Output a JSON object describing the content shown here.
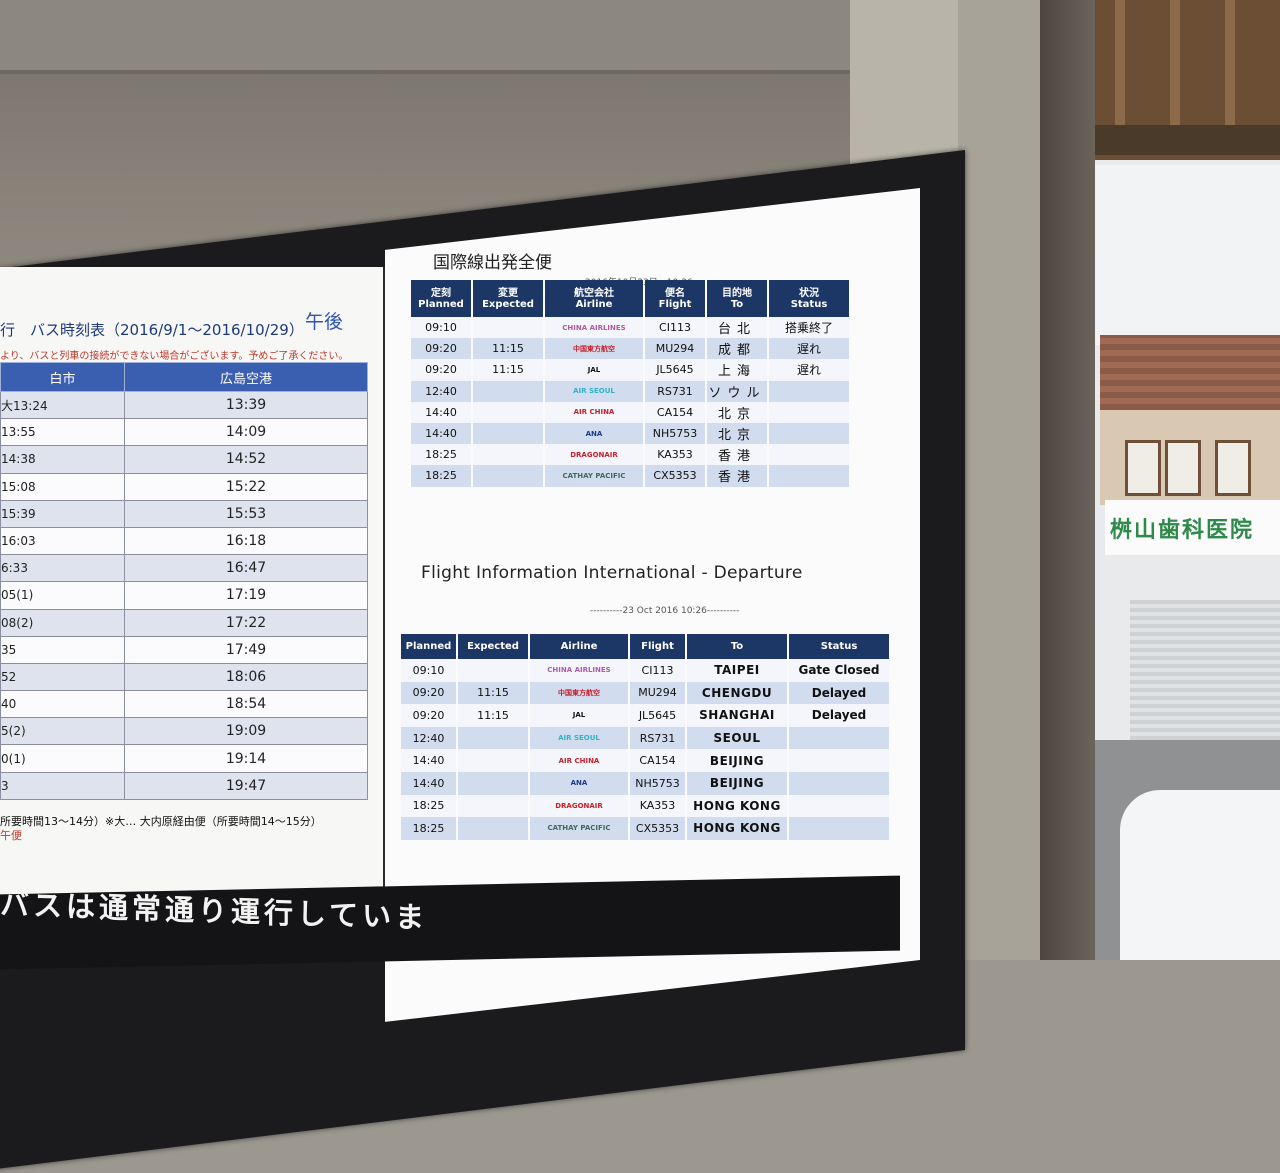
{
  "bus": {
    "title": "行　バス時刻表（2016/9/1〜2016/10/29）",
    "period": "午後",
    "note": "より、バスと列車の接続ができない場合がございます。予めご了承ください。",
    "col_from": "白市",
    "col_to": "広島空港",
    "rows": [
      {
        "from": "大13:24",
        "to": "13:39"
      },
      {
        "from": "13:55",
        "to": "14:09"
      },
      {
        "from": "14:38",
        "to": "14:52"
      },
      {
        "from": "15:08",
        "to": "15:22"
      },
      {
        "from": "15:39",
        "to": "15:53"
      },
      {
        "from": "16:03",
        "to": "16:18"
      },
      {
        "from": "6:33",
        "to": "16:47"
      },
      {
        "from": "05(1)",
        "to": "17:19"
      },
      {
        "from": "08(2)",
        "to": "17:22"
      },
      {
        "from": "35",
        "to": "17:49"
      },
      {
        "from": "52",
        "to": "18:06"
      },
      {
        "from": "40",
        "to": "18:54"
      },
      {
        "from": "5(2)",
        "to": "19:09"
      },
      {
        "from": "0(1)",
        "to": "19:14"
      },
      {
        "from": "3",
        "to": "19:47"
      }
    ],
    "footnote": "所要時間13〜14分）※大… 大内原経由便（所要時間14〜15分）",
    "footnote2": "午便",
    "ticker": "バスは通常通り運行していま"
  },
  "flights_jp": {
    "title": "国際線出発全便",
    "date": "2016年10月23日　10:26",
    "headers": [
      "定刻\nPlanned",
      "変更\nExpected",
      "航空会社\nAirline",
      "便名\nFlight",
      "目的地\nTo",
      "状況\nStatus"
    ],
    "rows": [
      {
        "planned": "09:10",
        "expected": "",
        "airline": "CHINA AIRLINES",
        "flight": "CI113",
        "to": "台北",
        "status": "搭乗終了"
      },
      {
        "planned": "09:20",
        "expected": "11:15",
        "airline": "中国東方航空",
        "flight": "MU294",
        "to": "成都",
        "status": "遅れ"
      },
      {
        "planned": "09:20",
        "expected": "11:15",
        "airline": "JAL",
        "flight": "JL5645",
        "to": "上海",
        "status": "遅れ"
      },
      {
        "planned": "12:40",
        "expected": "",
        "airline": "AIR SEOUL",
        "flight": "RS731",
        "to": "ソウル",
        "status": ""
      },
      {
        "planned": "14:40",
        "expected": "",
        "airline": "AIR CHINA",
        "flight": "CA154",
        "to": "北京",
        "status": ""
      },
      {
        "planned": "14:40",
        "expected": "",
        "airline": "ANA",
        "flight": "NH5753",
        "to": "北京",
        "status": ""
      },
      {
        "planned": "18:25",
        "expected": "",
        "airline": "DRAGONAIR",
        "flight": "KA353",
        "to": "香港",
        "status": ""
      },
      {
        "planned": "18:25",
        "expected": "",
        "airline": "CATHAY PACIFIC",
        "flight": "CX5353",
        "to": "香港",
        "status": ""
      }
    ]
  },
  "flights_en": {
    "title": "Flight Information International - Departure",
    "date": "----------23 Oct 2016 10:26----------",
    "headers": [
      "Planned",
      "Expected",
      "Airline",
      "Flight",
      "To",
      "Status"
    ],
    "rows": [
      {
        "planned": "09:10",
        "expected": "",
        "airline": "CHINA AIRLINES",
        "flight": "CI113",
        "to": "TAIPEI",
        "status": "Gate Closed"
      },
      {
        "planned": "09:20",
        "expected": "11:15",
        "airline": "中国東方航空",
        "flight": "MU294",
        "to": "CHENGDU",
        "status": "Delayed"
      },
      {
        "planned": "09:20",
        "expected": "11:15",
        "airline": "JAL",
        "flight": "JL5645",
        "to": "SHANGHAI",
        "status": "Delayed"
      },
      {
        "planned": "12:40",
        "expected": "",
        "airline": "AIR SEOUL",
        "flight": "RS731",
        "to": "SEOUL",
        "status": ""
      },
      {
        "planned": "14:40",
        "expected": "",
        "airline": "AIR CHINA",
        "flight": "CA154",
        "to": "BEIJING",
        "status": ""
      },
      {
        "planned": "14:40",
        "expected": "",
        "airline": "ANA",
        "flight": "NH5753",
        "to": "BEIJING",
        "status": ""
      },
      {
        "planned": "18:25",
        "expected": "",
        "airline": "DRAGONAIR",
        "flight": "KA353",
        "to": "HONG KONG",
        "status": ""
      },
      {
        "planned": "18:25",
        "expected": "",
        "airline": "CATHAY PACIFIC",
        "flight": "CX5353",
        "to": "HONG KONG",
        "status": ""
      }
    ]
  },
  "airline_colors": {
    "CHINA AIRLINES": "#b05aa8",
    "中国東方航空": "#c8202c",
    "JAL": "#111111",
    "AIR SEOUL": "#30b3c6",
    "AIR CHINA": "#c8202c",
    "ANA": "#1d3a8a",
    "DRAGONAIR": "#c8202c",
    "CATHAY PACIFIC": "#3f6a5f"
  },
  "colors": {
    "header_navy": "#1c3766",
    "row_alt": "#d2dcef",
    "bus_header": "#3b5fb0"
  },
  "clinic_sign": "桝山歯科医院"
}
